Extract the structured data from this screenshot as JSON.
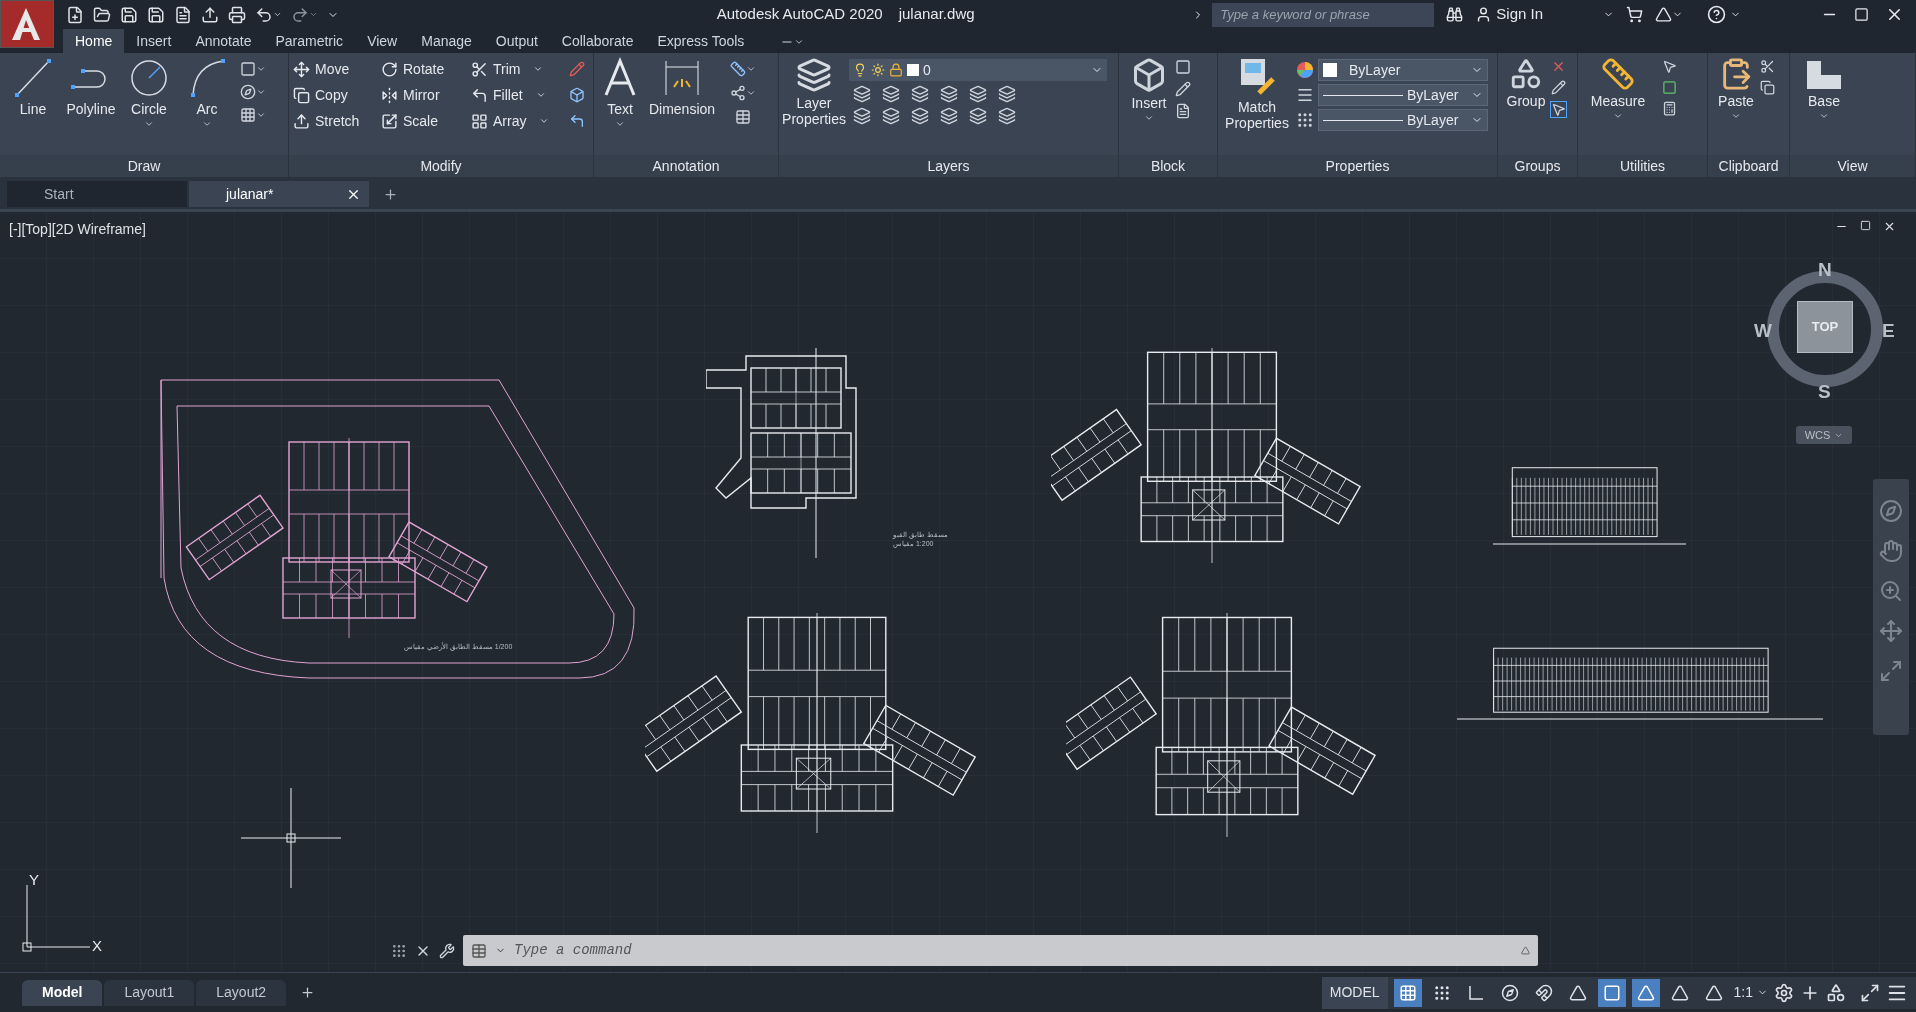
{
  "title_bar": {
    "app_title": "Autodesk AutoCAD 2020",
    "file_name": "julanar.dwg",
    "search": {
      "placeholder": "Type a keyword or phrase"
    },
    "sign_in": "Sign In"
  },
  "ribbon_tabs": [
    {
      "label": "Home",
      "selected": true
    },
    {
      "label": "Insert",
      "selected": false
    },
    {
      "label": "Annotate",
      "selected": false
    },
    {
      "label": "Parametric",
      "selected": false
    },
    {
      "label": "View",
      "selected": false
    },
    {
      "label": "Manage",
      "selected": false
    },
    {
      "label": "Output",
      "selected": false
    },
    {
      "label": "Collaborate",
      "selected": false
    },
    {
      "label": "Express Tools",
      "selected": false
    }
  ],
  "ribbon": {
    "draw": {
      "title": "Draw",
      "tools": [
        "Line",
        "Polyline",
        "Circle",
        "Arc"
      ]
    },
    "modify": {
      "title": "Modify",
      "tools": [
        "Move",
        "Rotate",
        "Trim",
        "Copy",
        "Mirror",
        "Fillet",
        "Stretch",
        "Scale",
        "Array"
      ]
    },
    "annotation": {
      "title": "Annotation",
      "tools": [
        "Text",
        "Dimension"
      ]
    },
    "layers": {
      "title": "Layers",
      "tool": "Layer Properties",
      "current_layer": "0"
    },
    "block": {
      "title": "Block",
      "tool": "Insert"
    },
    "properties": {
      "title": "Properties",
      "tool": "Match Properties",
      "color_setting": "ByLayer",
      "linetype": "ByLayer",
      "lineweight": "ByLayer"
    },
    "groups": {
      "title": "Groups",
      "tool": "Group"
    },
    "utilities": {
      "title": "Utilities",
      "tool": "Measure"
    },
    "clipboard": {
      "title": "Clipboard",
      "tool": "Paste"
    },
    "view": {
      "title": "View",
      "tool": "Base"
    }
  },
  "file_tabs": [
    {
      "label": "Start",
      "selected": false
    },
    {
      "label": "julanar*",
      "selected": true
    }
  ],
  "viewport": {
    "label": "[-][Top][2D Wireframe]"
  },
  "view_cube": {
    "north": "N",
    "east": "E",
    "south": "S",
    "west": "W",
    "face": "TOP",
    "ucs_menu": "WCS"
  },
  "ucs_icon": {
    "y": "Y",
    "x": "X"
  },
  "drawings": [
    {
      "kind": "site-plan",
      "caption": "1/200 مسقط الطابق الأرضي مقياس"
    },
    {
      "kind": "basement-plan",
      "caption": "مسقط طابق القبو",
      "scale": "1:200 مقياس"
    },
    {
      "kind": "plan"
    },
    {
      "kind": "elevation"
    },
    {
      "kind": "plan"
    },
    {
      "kind": "plan"
    },
    {
      "kind": "elevation"
    }
  ],
  "command_line": {
    "placeholder": "Type a command"
  },
  "layout_tabs": [
    {
      "label": "Model",
      "selected": true
    },
    {
      "label": "Layout1",
      "selected": false
    },
    {
      "label": "Layout2",
      "selected": false
    }
  ],
  "status_bar": {
    "space": "MODEL",
    "scale": "1:1",
    "toggles": [
      {
        "kind": "grid",
        "on": true
      },
      {
        "kind": "snap",
        "on": false
      },
      {
        "kind": "ortho",
        "on": false
      },
      {
        "kind": "polar",
        "on": false
      },
      {
        "kind": "isnap",
        "on": false
      },
      {
        "kind": "angle",
        "on": false
      },
      {
        "kind": "osnap",
        "on": true
      },
      {
        "kind": "annovis",
        "on": true
      },
      {
        "kind": "autoscale",
        "on": false
      },
      {
        "kind": "annoscale",
        "on": false
      }
    ]
  }
}
